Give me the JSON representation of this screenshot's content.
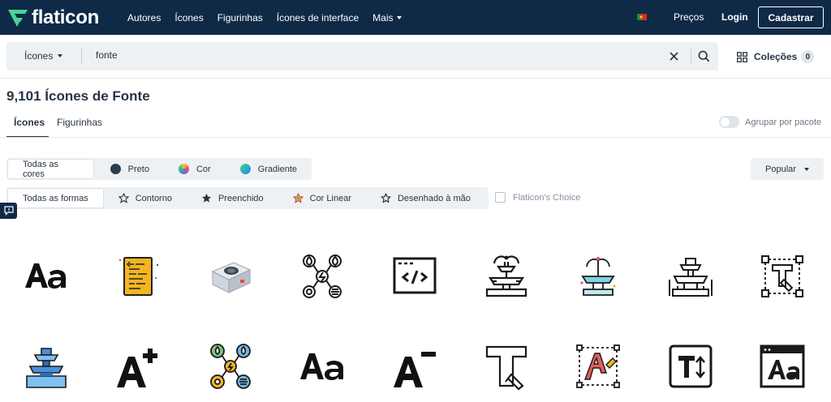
{
  "nav": {
    "logo": "flaticon",
    "links": [
      "Autores",
      "Ícones",
      "Figurinhas",
      "Ícones de interface",
      "Mais"
    ],
    "prices": "Preços",
    "login": "Login",
    "signup": "Cadastrar"
  },
  "search": {
    "type": "Ícones",
    "value": "fonte"
  },
  "collections": {
    "label": "Coleções",
    "count": "0"
  },
  "title": "9,101 Ícones de Fonte",
  "tabs": [
    {
      "label": "Ícones",
      "active": true
    },
    {
      "label": "Figurinhas",
      "active": false
    }
  ],
  "pack_toggle": "Agrupar por pacote",
  "color_filters": [
    {
      "label": "Todas as cores",
      "active": true
    },
    {
      "label": "Preto",
      "swatch": "#2d3e50"
    },
    {
      "label": "Cor",
      "swatch": "conic"
    },
    {
      "label": "Gradiente",
      "swatch": "gradient"
    }
  ],
  "shape_filters": [
    {
      "label": "Todas as formas",
      "active": true
    },
    {
      "label": "Contorno",
      "icon": "star-outline-icon"
    },
    {
      "label": "Preenchido",
      "icon": "star-filled-icon"
    },
    {
      "label": "Cor Linear",
      "icon": "star-color-icon"
    },
    {
      "label": "Desenhado à mão",
      "icon": "star-hand-icon"
    }
  ],
  "sort": "Popular",
  "flaticon_choice": "Flaticon's Choice",
  "colors": {
    "nav_bg": "#0e2a47",
    "brand_green": "#4ad295",
    "accent": "#1fb5a3"
  }
}
